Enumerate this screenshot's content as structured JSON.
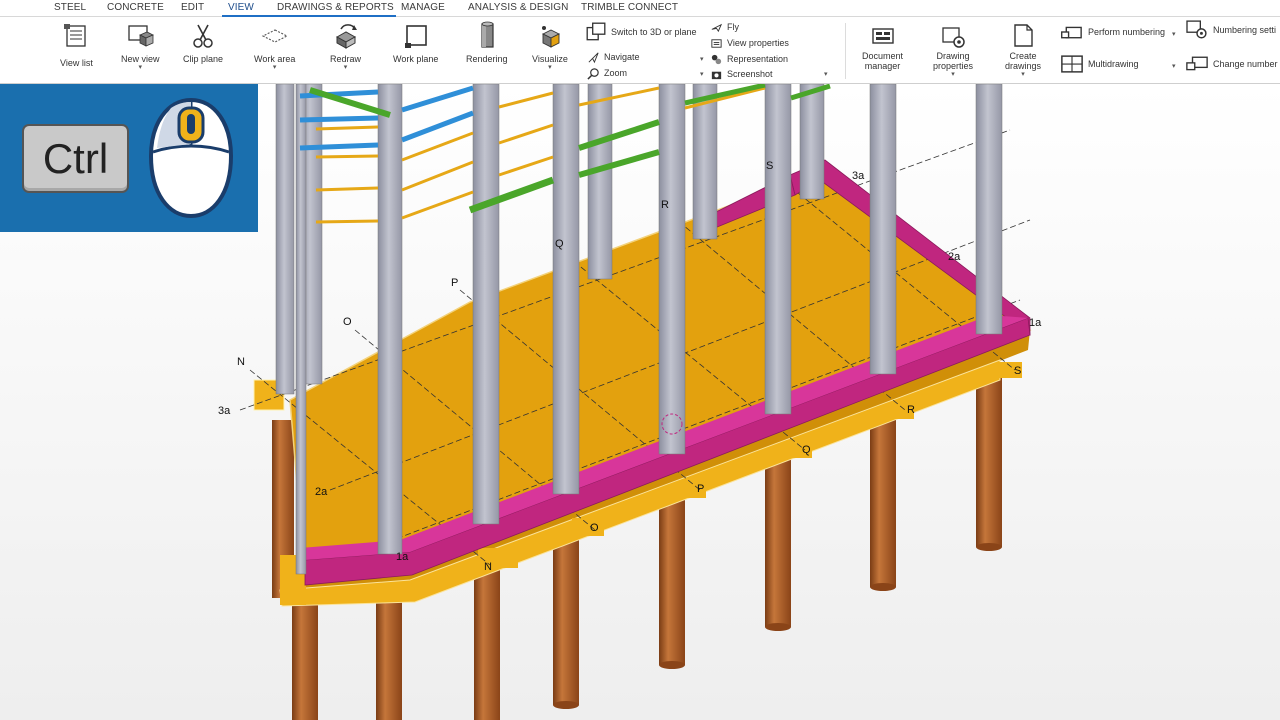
{
  "tabs": [
    {
      "label": "STEEL",
      "active": false
    },
    {
      "label": "CONCRETE",
      "active": false
    },
    {
      "label": "EDIT",
      "active": false
    },
    {
      "label": "VIEW",
      "active": true
    },
    {
      "label": "DRAWINGS & REPORTS",
      "active": false
    },
    {
      "label": "MANAGE",
      "active": false
    },
    {
      "label": "ANALYSIS & DESIGN",
      "active": false
    },
    {
      "label": "TRIMBLE CONNECT",
      "active": false
    }
  ],
  "ribbon": {
    "view_list": "View list",
    "new_view": "New view",
    "clip_plane": "Clip plane",
    "work_area": "Work area",
    "redraw": "Redraw",
    "work_plane": "Work plane",
    "rendering": "Rendering",
    "visualize": "Visualize",
    "switch_3d": "Switch to 3D or plane",
    "navigate": "Navigate",
    "zoom": "Zoom",
    "fly": "Fly",
    "view_properties": "View properties",
    "representation": "Representation",
    "screenshot": "Screenshot",
    "document_manager_1": "Document",
    "document_manager_2": "manager",
    "drawing_properties_1": "Drawing",
    "drawing_properties_2": "properties",
    "create_drawings_1": "Create",
    "create_drawings_2": "drawings",
    "perform_numbering": "Perform numbering",
    "multidrawing": "Multidrawing",
    "numbering_settings": "Numbering setti",
    "change_number": "Change number"
  },
  "overlay": {
    "key_label": "Ctrl"
  },
  "grid_labels": {
    "n_top": "N",
    "o_top": "O",
    "p_top": "P",
    "q_top": "Q",
    "r_top": "R",
    "s_top": "S",
    "n_bottom": "N",
    "o_bottom": "O",
    "p_bottom": "P",
    "q_bottom": "Q",
    "r_bottom": "R",
    "s_bottom": "S",
    "a3_left": "3a",
    "a2_left": "2a",
    "a1_front": "1a",
    "a3_right": "3a",
    "a2_right": "2a",
    "a1_right": "1a"
  },
  "colors": {
    "slab": "#e3a10e",
    "edge_beam": "#c0267f",
    "column": "#a4a7b5",
    "pile": "#b0602a",
    "beam_blue": "#2f8fd8",
    "beam_yellow": "#e6a817",
    "beam_green": "#4aa62a",
    "overlay_bg": "#1a6fae",
    "accent": "#1f6fc5"
  }
}
